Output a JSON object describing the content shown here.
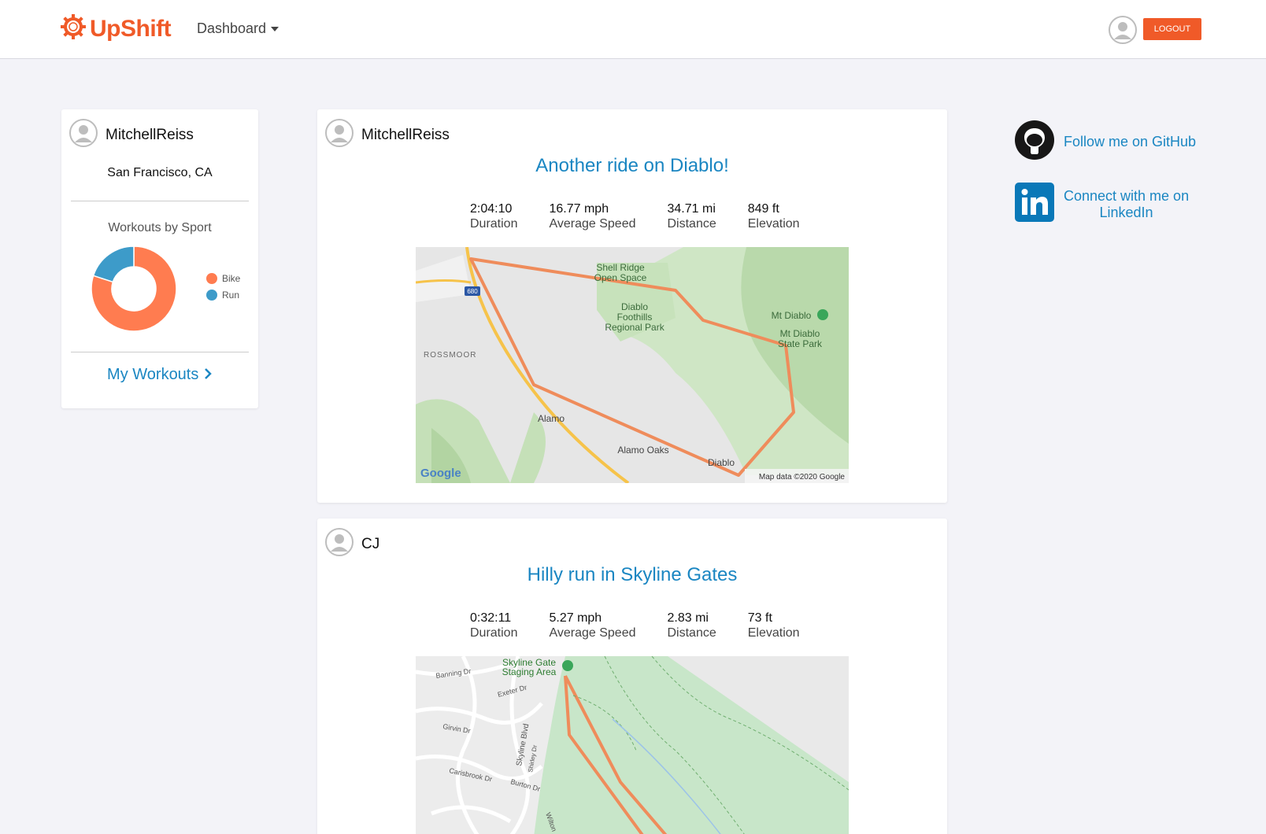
{
  "header": {
    "brand": "UpShift",
    "nav_dashboard": "Dashboard",
    "logout": "LOGOUT"
  },
  "profile": {
    "username": "MitchellReiss",
    "location": "San Francisco, CA",
    "chart_title": "Workouts by Sport",
    "my_workouts": "My Workouts"
  },
  "chart_data": {
    "type": "pie",
    "title": "Workouts by Sport",
    "series": [
      {
        "name": "Bike",
        "value": 80,
        "color": "#ff7c50"
      },
      {
        "name": "Run",
        "value": 20,
        "color": "#3d9bc9"
      }
    ],
    "legend": "right"
  },
  "posts": [
    {
      "user": "MitchellReiss",
      "title": "Another ride on Diablo!",
      "stats": [
        {
          "value": "2:04:10",
          "label": "Duration"
        },
        {
          "value": "16.77 mph",
          "label": "Average Speed"
        },
        {
          "value": "34.71 mi",
          "label": "Distance"
        },
        {
          "value": "849 ft",
          "label": "Elevation"
        }
      ],
      "map_labels": {
        "shell_ridge": "Shell Ridge",
        "open_space": "Open Space",
        "diablo_foothills_1": "Diablo",
        "diablo_foothills_2": "Foothills",
        "diablo_foothills_3": "Regional Park",
        "mt_diablo": "Mt Diablo",
        "state_park_1": "Mt Diablo",
        "state_park_2": "State Park",
        "rossmoor": "ROSSMOOR",
        "alamo": "Alamo",
        "alamo_oaks": "Alamo Oaks",
        "diablo": "Diablo",
        "highway": "680",
        "google": "Google",
        "copyright": "Map data ©2020 Google"
      }
    },
    {
      "user": "CJ",
      "title": "Hilly run in Skyline Gates",
      "stats": [
        {
          "value": "0:32:11",
          "label": "Duration"
        },
        {
          "value": "5.27 mph",
          "label": "Average Speed"
        },
        {
          "value": "2.83 mi",
          "label": "Distance"
        },
        {
          "value": "73 ft",
          "label": "Elevation"
        }
      ],
      "map_labels": {
        "staging_1": "Skyline Gate",
        "staging_2": "Staging Area",
        "banning": "Banning Dr",
        "exeter": "Exeter Dr",
        "girvin": "Girvin Dr",
        "skyline": "Skyline Blvd",
        "shirley": "Shirley Dr",
        "carisbrook": "Carisbrook Dr",
        "burton": "Burton Dr",
        "wilton": "Wilton"
      }
    }
  ],
  "social": {
    "github": "Follow me on GitHub",
    "linkedin_1": "Connect with me on",
    "linkedin_2": "LinkedIn"
  }
}
